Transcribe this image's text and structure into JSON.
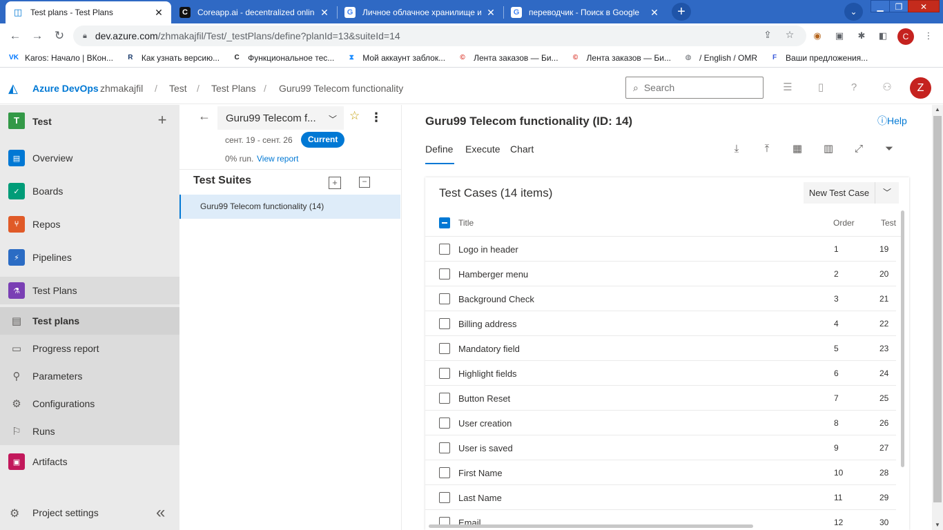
{
  "browser": {
    "tabs": [
      {
        "title": "Test plans - Test Plans",
        "icon": "azure-devops-favicon",
        "active": true
      },
      {
        "title": "Coreapp.ai - decentralized online ec",
        "icon": "coreapp-favicon",
        "active": false
      },
      {
        "title": "Личное облачное хранилище и пл",
        "icon": "google-favicon",
        "active": false
      },
      {
        "title": "переводчик - Поиск в Google",
        "icon": "google-favicon",
        "active": false
      }
    ],
    "close_glyph": "✕",
    "new_tab_glyph": "+",
    "url_host": "dev.azure.com",
    "url_path": "/zhmakajfil/Test/_testPlans/define?planId=13&suiteId=14",
    "profile_initial": "C"
  },
  "bookmarks": [
    {
      "label": "Karos: Начало | ВКон...",
      "icon": "vk-icon",
      "color": "#0077ff",
      "glyph": "VK"
    },
    {
      "label": "Как узнать версию...",
      "icon": "r-icon",
      "color": "#1a3a6b",
      "glyph": "R"
    },
    {
      "label": "Функциональное тес...",
      "icon": "c-icon",
      "color": "#202124",
      "glyph": "C"
    },
    {
      "label": "Мой аккаунт заблок...",
      "icon": "hourglass-icon",
      "color": "#1a8cff",
      "glyph": "⧗"
    },
    {
      "label": "Лента заказов — Би...",
      "icon": "copyright-icon",
      "color": "#d93025",
      "glyph": "©"
    },
    {
      "label": "Лента заказов — Би...",
      "icon": "copyright-icon",
      "color": "#d93025",
      "glyph": "©"
    },
    {
      "label": "/ English / OMR",
      "icon": "globe-icon",
      "color": "#5f6368",
      "glyph": "◍"
    },
    {
      "label": "Ваши предложения...",
      "icon": "f-icon",
      "color": "#3b5bdb",
      "glyph": "F"
    }
  ],
  "header": {
    "brand": "Azure DevOps",
    "breadcrumbs": [
      "zhmakajfil",
      "Test",
      "Test Plans",
      "Guru99 Telecom functionality"
    ],
    "search_placeholder": "Search",
    "user_initial": "Z"
  },
  "project": {
    "badge": "T",
    "name": "Test",
    "add_glyph": "+"
  },
  "nav": {
    "items": [
      {
        "label": "Overview",
        "icon": "overview-icon",
        "color": "#0078d4"
      },
      {
        "label": "Boards",
        "icon": "boards-icon",
        "color": "#009c78"
      },
      {
        "label": "Repos",
        "icon": "repos-icon",
        "color": "#e05a28"
      },
      {
        "label": "Pipelines",
        "icon": "pipelines-icon",
        "color": "#2b6cc4"
      },
      {
        "label": "Test Plans",
        "icon": "test-plans-icon",
        "color": "#7a3fb4"
      }
    ],
    "subitems": [
      {
        "label": "Test plans",
        "icon": "test-plans-list-icon"
      },
      {
        "label": "Progress report",
        "icon": "progress-report-icon"
      },
      {
        "label": "Parameters",
        "icon": "parameters-icon"
      },
      {
        "label": "Configurations",
        "icon": "configurations-icon"
      },
      {
        "label": "Runs",
        "icon": "runs-icon"
      }
    ],
    "artifacts": {
      "label": "Artifacts",
      "icon": "artifacts-icon",
      "color": "#c2185b"
    },
    "settings": "Project settings",
    "collapse_glyph": "«"
  },
  "plan": {
    "name": "Guru99 Telecom f...",
    "dates": "сент. 19 - сент. 26",
    "badge": "Current",
    "run": "0% run.",
    "report_link": "View report"
  },
  "suites": {
    "title": "Test Suites",
    "items": [
      {
        "label": "Guru99 Telecom functionality (14)"
      }
    ]
  },
  "main": {
    "title": "Guru99 Telecom functionality (ID: 14)",
    "help": "Help",
    "tabs": [
      "Define",
      "Execute",
      "Chart"
    ],
    "cases_title": "Test Cases (14 items)",
    "new_case": "New Test Case",
    "columns": [
      "Title",
      "Order",
      "Test"
    ],
    "rows": [
      {
        "title": "Logo in header",
        "order": "1",
        "id": "19"
      },
      {
        "title": "Hamberger menu",
        "order": "2",
        "id": "20"
      },
      {
        "title": "Background Check",
        "order": "3",
        "id": "21"
      },
      {
        "title": "Billing address",
        "order": "4",
        "id": "22"
      },
      {
        "title": "Mandatory field",
        "order": "5",
        "id": "23"
      },
      {
        "title": "Highlight fields",
        "order": "6",
        "id": "24"
      },
      {
        "title": "Button Reset",
        "order": "7",
        "id": "25"
      },
      {
        "title": "User creation",
        "order": "8",
        "id": "26"
      },
      {
        "title": "User is saved",
        "order": "9",
        "id": "27"
      },
      {
        "title": "First Name",
        "order": "10",
        "id": "28"
      },
      {
        "title": "Last Name",
        "order": "11",
        "id": "29"
      },
      {
        "title": "Email",
        "order": "12",
        "id": "30"
      }
    ]
  }
}
